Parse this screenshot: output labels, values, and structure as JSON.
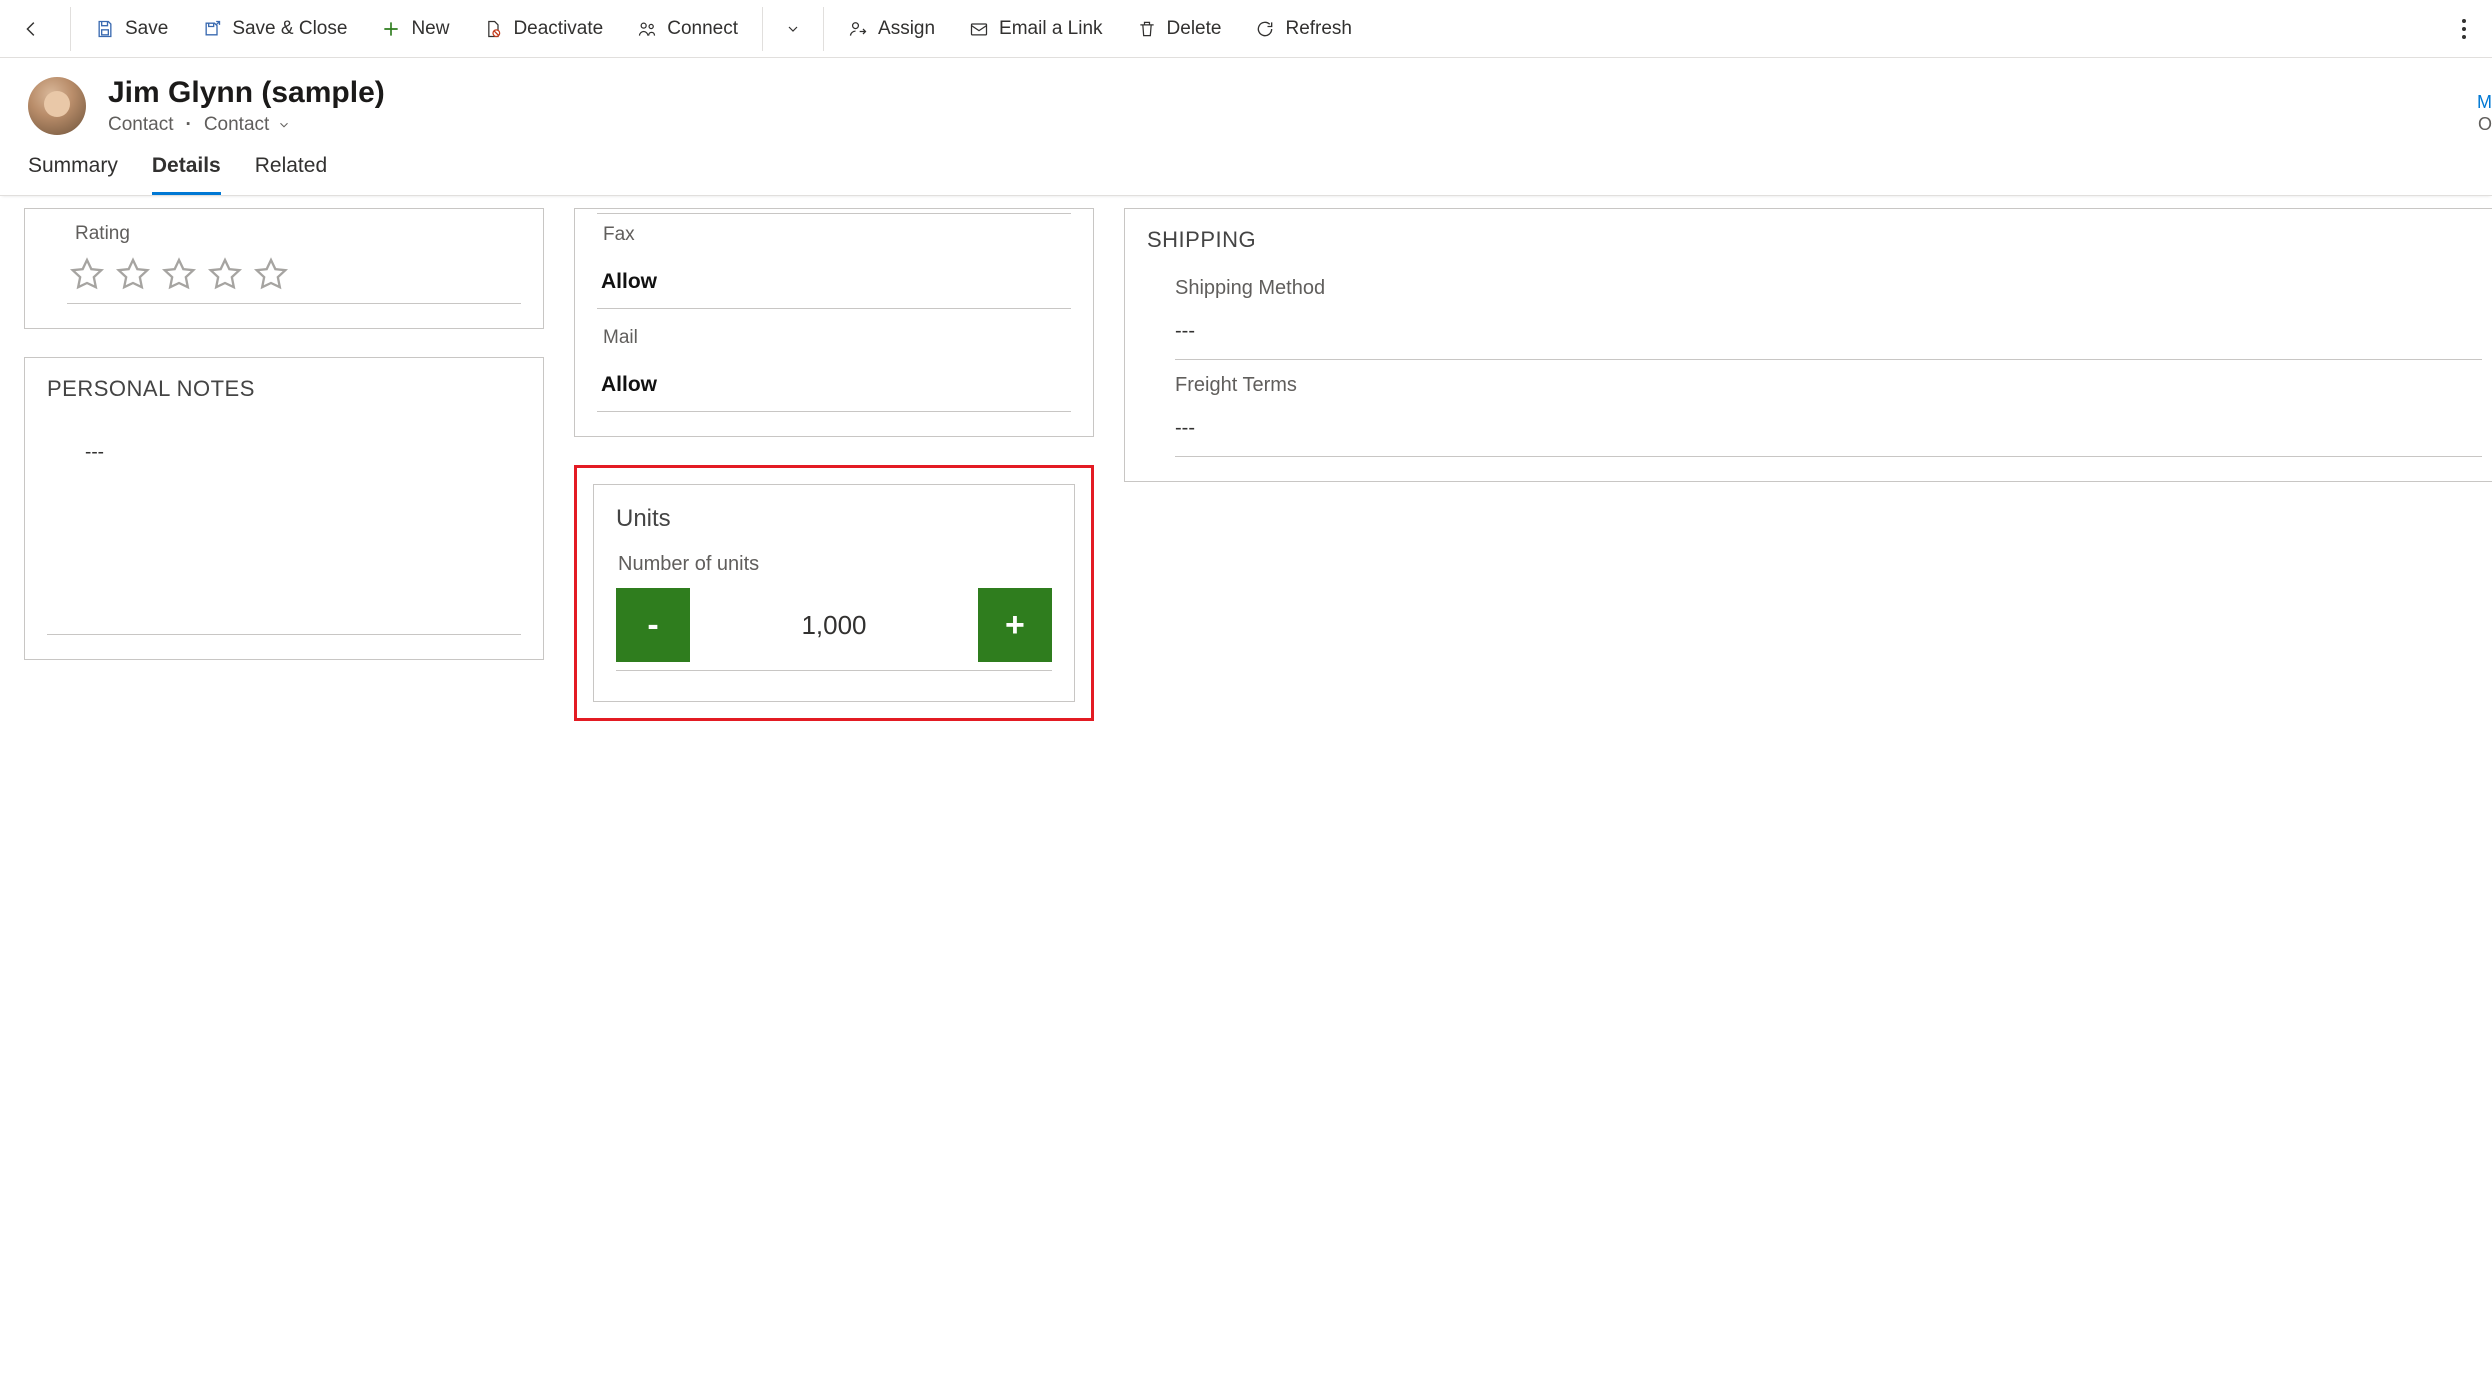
{
  "commands": {
    "save": "Save",
    "save_close": "Save & Close",
    "new": "New",
    "deactivate": "Deactivate",
    "connect": "Connect",
    "assign": "Assign",
    "email_link": "Email a Link",
    "delete": "Delete",
    "refresh": "Refresh"
  },
  "header": {
    "title": "Jim Glynn (sample)",
    "entity": "Contact",
    "form": "Contact"
  },
  "peek": {
    "line1": "M",
    "line2": "O"
  },
  "tabs": {
    "summary": "Summary",
    "details": "Details",
    "related": "Related"
  },
  "left": {
    "rating_label": "Rating",
    "personal_notes_title": "PERSONAL NOTES",
    "personal_notes_value": "---"
  },
  "mid": {
    "fax_label": "Fax",
    "fax_value": "Allow",
    "mail_label": "Mail",
    "mail_value": "Allow",
    "units_title": "Units",
    "units_field_label": "Number of units",
    "units_value": "1,000",
    "minus": "-",
    "plus": "+"
  },
  "right": {
    "shipping_title": "SHIPPING",
    "shipping_method_label": "Shipping Method",
    "shipping_method_value": "---",
    "freight_terms_label": "Freight Terms",
    "freight_terms_value": "---"
  }
}
